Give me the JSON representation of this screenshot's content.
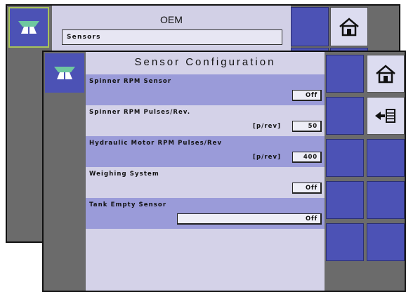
{
  "back_window": {
    "title": "OEM",
    "dropdown_value": "Sensors",
    "mode_icon": "spreader-icon",
    "home_icon": "home-icon"
  },
  "front_window": {
    "title": "Sensor Configuration",
    "mode_icon": "spreader-icon",
    "rows": [
      {
        "label": "Spinner RPM Sensor",
        "unit": "",
        "value": "Off"
      },
      {
        "label": "Spinner RPM Pulses/Rev.",
        "unit": "[p/rev]",
        "value": "50"
      },
      {
        "label": "Hydraulic Motor RPM Pulses/Rev",
        "unit": "[p/rev]",
        "value": "400"
      },
      {
        "label": "Weighing System",
        "unit": "",
        "value": "Off"
      },
      {
        "label": "Tank Empty Sensor",
        "unit": "",
        "value": "Off"
      }
    ],
    "icons": {
      "home": "home-icon",
      "back": "back-list-icon"
    }
  },
  "colors": {
    "accent_blue": "#4c52b5",
    "row_highlight": "#9a9bd9",
    "panel_bg": "#d4d2e8",
    "frame_gray": "#6b6b6b"
  }
}
